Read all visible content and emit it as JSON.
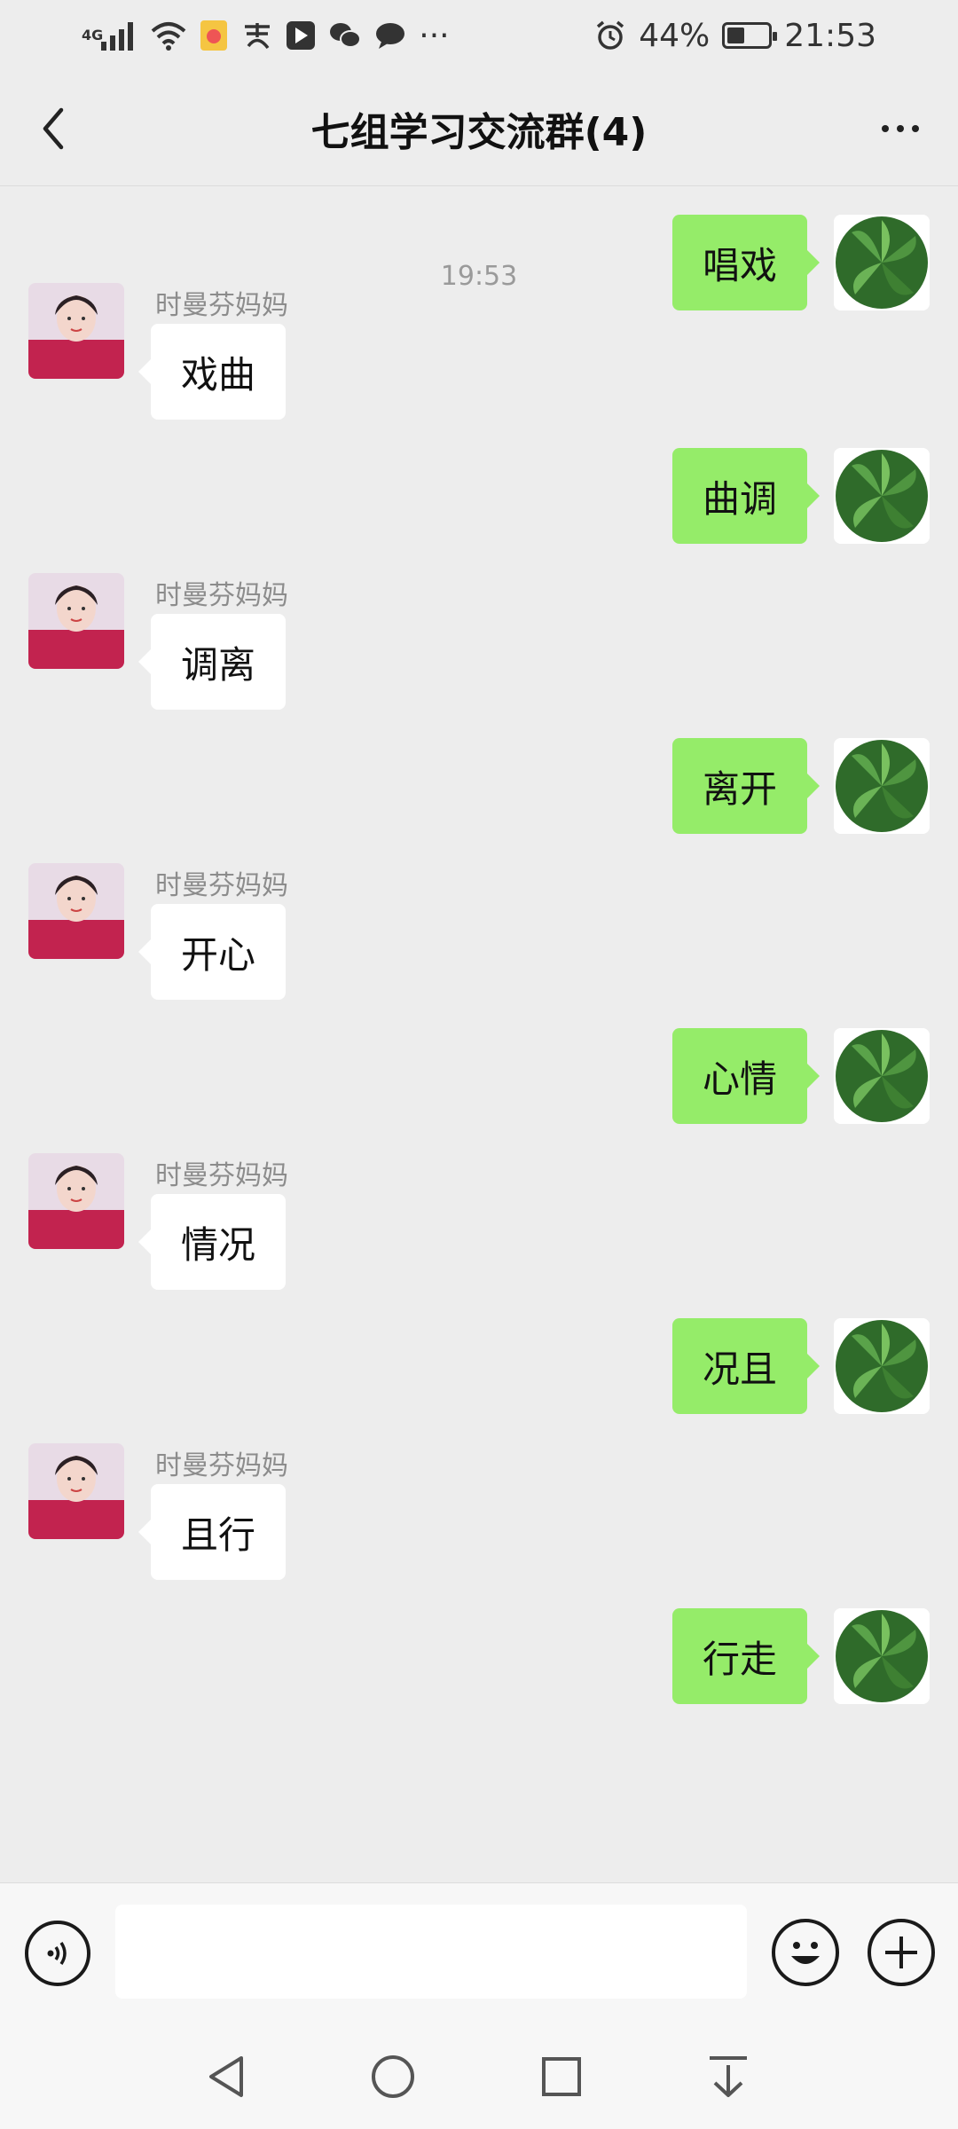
{
  "status_bar": {
    "network_label": "4G",
    "battery_percent": "44%",
    "battery_level": 0.44,
    "time": "21:53",
    "overflow": "···"
  },
  "header": {
    "title": "七组学习交流群(4)"
  },
  "chat": {
    "timestamp": "19:53",
    "messages": [
      {
        "side": "right",
        "text": "唱戏"
      },
      {
        "side": "left",
        "sender": "时曼芬妈妈",
        "text": "戏曲"
      },
      {
        "side": "right",
        "text": "曲调"
      },
      {
        "side": "left",
        "sender": "时曼芬妈妈",
        "text": "调离"
      },
      {
        "side": "right",
        "text": "离开"
      },
      {
        "side": "left",
        "sender": "时曼芬妈妈",
        "text": "开心"
      },
      {
        "side": "right",
        "text": "心情"
      },
      {
        "side": "left",
        "sender": "时曼芬妈妈",
        "text": "情况"
      },
      {
        "side": "right",
        "text": "况且"
      },
      {
        "side": "left",
        "sender": "时曼芬妈妈",
        "text": "且行"
      },
      {
        "side": "right",
        "text": "行走"
      }
    ]
  },
  "input_bar": {
    "value": "",
    "placeholder": ""
  },
  "icons": {
    "back": "chevron-left-icon",
    "more": "more-dots-icon",
    "voice": "voice-icon",
    "emoji": "emoji-icon",
    "plus": "plus-icon",
    "nav_back": "triangle-back-icon",
    "nav_home": "circle-home-icon",
    "nav_recent": "square-recent-icon",
    "nav_down": "pull-down-icon"
  },
  "colors": {
    "chat_bg": "#ededed",
    "sent_bubble": "#95ec69",
    "received_bubble": "#ffffff"
  }
}
